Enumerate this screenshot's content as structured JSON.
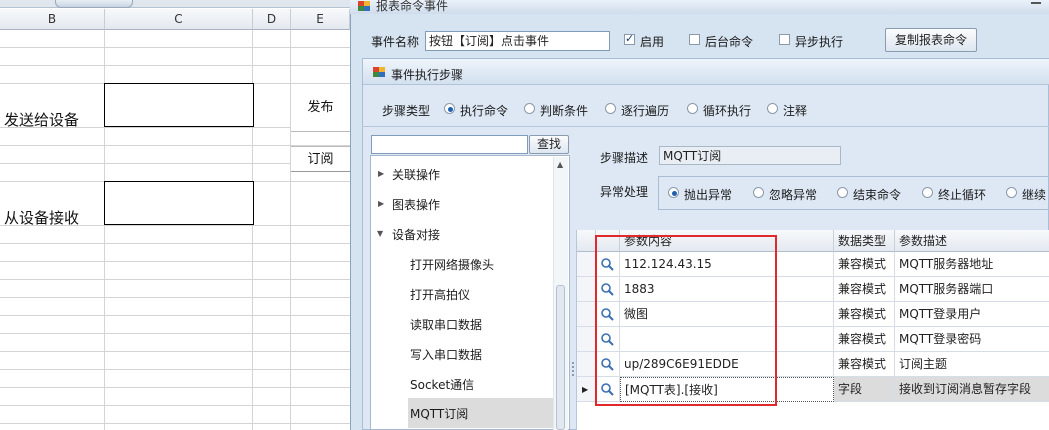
{
  "spreadsheet": {
    "columns": [
      "B",
      "C",
      "D",
      "E"
    ],
    "labels": {
      "send": "发送给设备",
      "receive": "从设备接收"
    },
    "buttons": {
      "publish": "发布",
      "subscribe": "订阅"
    }
  },
  "dialog": {
    "title": "报表命令事件",
    "event_name_label": "事件名称",
    "event_name_value": "按钮【订阅】点击事件",
    "checkboxes": [
      {
        "label": "启用",
        "checked": true
      },
      {
        "label": "后台命令",
        "checked": false
      },
      {
        "label": "异步执行",
        "checked": false
      }
    ],
    "copy_button": "复制报表命令",
    "panel_title": "事件执行步骤",
    "step_type_label": "步骤类型",
    "step_types": [
      {
        "label": "执行命令",
        "selected": true
      },
      {
        "label": "判断条件",
        "selected": false
      },
      {
        "label": "逐行遍历",
        "selected": false
      },
      {
        "label": "循环执行",
        "selected": false
      },
      {
        "label": "注释",
        "selected": false
      }
    ],
    "search_button": "查找",
    "search_value": "",
    "tree": {
      "groups": [
        {
          "label": "关联操作",
          "expanded": false
        },
        {
          "label": "图表操作",
          "expanded": false
        },
        {
          "label": "设备对接",
          "expanded": true
        }
      ],
      "children": [
        "打开网络摄像头",
        "打开高拍仪",
        "读取串口数据",
        "写入串口数据",
        "Socket通信",
        "MQTT订阅"
      ],
      "selected": "MQTT订阅"
    },
    "step_desc_label": "步骤描述",
    "step_desc_value": "MQTT订阅",
    "exception_label": "异常处理",
    "exception_options": [
      {
        "label": "抛出异常",
        "selected": true
      },
      {
        "label": "忽略异常",
        "selected": false
      },
      {
        "label": "结束命令",
        "selected": false
      },
      {
        "label": "终止循环",
        "selected": false
      },
      {
        "label": "继续",
        "selected": false
      }
    ],
    "grid": {
      "headers": [
        "参数内容",
        "数据类型",
        "参数描述"
      ],
      "rows": [
        {
          "content": "112.124.43.15",
          "type": "兼容模式",
          "desc": "MQTT服务器地址"
        },
        {
          "content": "1883",
          "type": "兼容模式",
          "desc": "MQTT服务器端口"
        },
        {
          "content": "微图",
          "type": "兼容模式",
          "desc": "MQTT登录用户"
        },
        {
          "content": "",
          "type": "兼容模式",
          "desc": "MQTT登录密码"
        },
        {
          "content": "up/289C6E91EDDE",
          "type": "兼容模式",
          "desc": "订阅主题"
        },
        {
          "content": "[MQTT表].[接收]",
          "type": "字段",
          "desc": "接收到订阅消息暂存字段"
        }
      ]
    }
  },
  "colors": {
    "highlight_box": "#e0292d",
    "dialog_bg": "#d6e3f1"
  }
}
